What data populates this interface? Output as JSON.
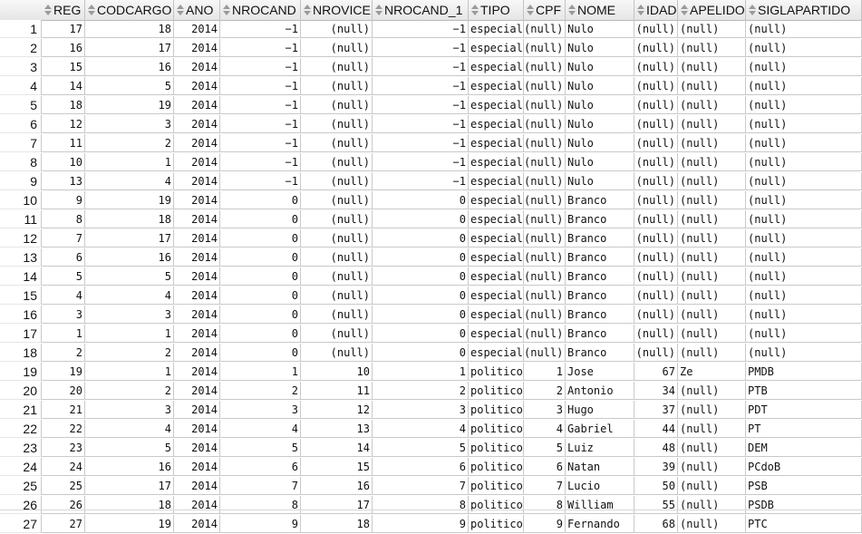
{
  "table": {
    "columns": [
      "REG",
      "CODCARGO",
      "ANO",
      "NROCAND",
      "NROVICE",
      "NROCAND_1",
      "TIPO",
      "CPF",
      "NOME",
      "IDADE",
      "APELIDO",
      "SIGLAPARTIDO"
    ],
    "rows": [
      [
        "1",
        "17",
        "18",
        "2014",
        "−1",
        "(null)",
        "−1",
        "especial",
        "(null)",
        "Nulo",
        "(null)",
        "(null)",
        "(null)"
      ],
      [
        "2",
        "16",
        "17",
        "2014",
        "−1",
        "(null)",
        "−1",
        "especial",
        "(null)",
        "Nulo",
        "(null)",
        "(null)",
        "(null)"
      ],
      [
        "3",
        "15",
        "16",
        "2014",
        "−1",
        "(null)",
        "−1",
        "especial",
        "(null)",
        "Nulo",
        "(null)",
        "(null)",
        "(null)"
      ],
      [
        "4",
        "14",
        "5",
        "2014",
        "−1",
        "(null)",
        "−1",
        "especial",
        "(null)",
        "Nulo",
        "(null)",
        "(null)",
        "(null)"
      ],
      [
        "5",
        "18",
        "19",
        "2014",
        "−1",
        "(null)",
        "−1",
        "especial",
        "(null)",
        "Nulo",
        "(null)",
        "(null)",
        "(null)"
      ],
      [
        "6",
        "12",
        "3",
        "2014",
        "−1",
        "(null)",
        "−1",
        "especial",
        "(null)",
        "Nulo",
        "(null)",
        "(null)",
        "(null)"
      ],
      [
        "7",
        "11",
        "2",
        "2014",
        "−1",
        "(null)",
        "−1",
        "especial",
        "(null)",
        "Nulo",
        "(null)",
        "(null)",
        "(null)"
      ],
      [
        "8",
        "10",
        "1",
        "2014",
        "−1",
        "(null)",
        "−1",
        "especial",
        "(null)",
        "Nulo",
        "(null)",
        "(null)",
        "(null)"
      ],
      [
        "9",
        "13",
        "4",
        "2014",
        "−1",
        "(null)",
        "−1",
        "especial",
        "(null)",
        "Nulo",
        "(null)",
        "(null)",
        "(null)"
      ],
      [
        "10",
        "9",
        "19",
        "2014",
        "0",
        "(null)",
        "0",
        "especial",
        "(null)",
        "Branco",
        "(null)",
        "(null)",
        "(null)"
      ],
      [
        "11",
        "8",
        "18",
        "2014",
        "0",
        "(null)",
        "0",
        "especial",
        "(null)",
        "Branco",
        "(null)",
        "(null)",
        "(null)"
      ],
      [
        "12",
        "7",
        "17",
        "2014",
        "0",
        "(null)",
        "0",
        "especial",
        "(null)",
        "Branco",
        "(null)",
        "(null)",
        "(null)"
      ],
      [
        "13",
        "6",
        "16",
        "2014",
        "0",
        "(null)",
        "0",
        "especial",
        "(null)",
        "Branco",
        "(null)",
        "(null)",
        "(null)"
      ],
      [
        "14",
        "5",
        "5",
        "2014",
        "0",
        "(null)",
        "0",
        "especial",
        "(null)",
        "Branco",
        "(null)",
        "(null)",
        "(null)"
      ],
      [
        "15",
        "4",
        "4",
        "2014",
        "0",
        "(null)",
        "0",
        "especial",
        "(null)",
        "Branco",
        "(null)",
        "(null)",
        "(null)"
      ],
      [
        "16",
        "3",
        "3",
        "2014",
        "0",
        "(null)",
        "0",
        "especial",
        "(null)",
        "Branco",
        "(null)",
        "(null)",
        "(null)"
      ],
      [
        "17",
        "1",
        "1",
        "2014",
        "0",
        "(null)",
        "0",
        "especial",
        "(null)",
        "Branco",
        "(null)",
        "(null)",
        "(null)"
      ],
      [
        "18",
        "2",
        "2",
        "2014",
        "0",
        "(null)",
        "0",
        "especial",
        "(null)",
        "Branco",
        "(null)",
        "(null)",
        "(null)"
      ],
      [
        "19",
        "19",
        "1",
        "2014",
        "1",
        "10",
        "1",
        "politico",
        "1",
        "Jose",
        "67",
        "Ze",
        "PMDB"
      ],
      [
        "20",
        "20",
        "2",
        "2014",
        "2",
        "11",
        "2",
        "politico",
        "2",
        "Antonio",
        "34",
        "(null)",
        "PTB"
      ],
      [
        "21",
        "21",
        "3",
        "2014",
        "3",
        "12",
        "3",
        "politico",
        "3",
        "Hugo",
        "37",
        "(null)",
        "PDT"
      ],
      [
        "22",
        "22",
        "4",
        "2014",
        "4",
        "13",
        "4",
        "politico",
        "4",
        "Gabriel",
        "44",
        "(null)",
        "PT"
      ],
      [
        "23",
        "23",
        "5",
        "2014",
        "5",
        "14",
        "5",
        "politico",
        "5",
        "Luiz",
        "48",
        "(null)",
        "DEM"
      ],
      [
        "24",
        "24",
        "16",
        "2014",
        "6",
        "15",
        "6",
        "politico",
        "6",
        "Natan",
        "39",
        "(null)",
        "PCdoB"
      ],
      [
        "25",
        "25",
        "17",
        "2014",
        "7",
        "16",
        "7",
        "politico",
        "7",
        "Lucio",
        "50",
        "(null)",
        "PSB"
      ],
      [
        "26",
        "26",
        "18",
        "2014",
        "8",
        "17",
        "8",
        "politico",
        "8",
        "William",
        "55",
        "(null)",
        "PSDB"
      ],
      [
        "27",
        "27",
        "19",
        "2014",
        "9",
        "18",
        "9",
        "politico",
        "9",
        "Fernando",
        "68",
        "(null)",
        "PTC"
      ]
    ]
  }
}
